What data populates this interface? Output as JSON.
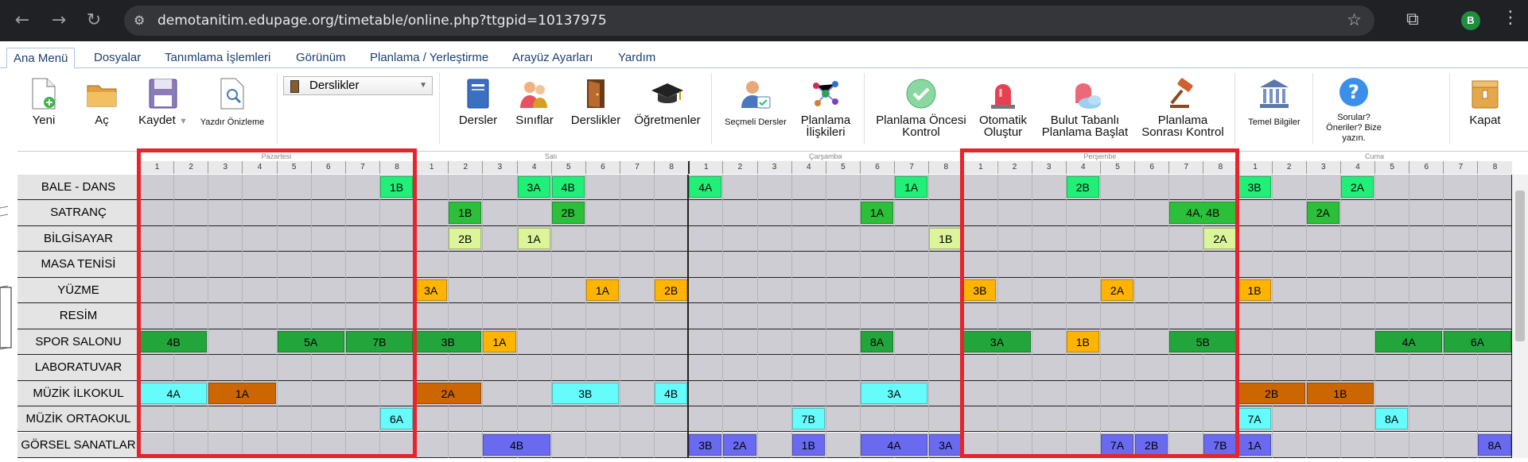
{
  "browser": {
    "url": "demotanitim.edupage.org/timetable/online.php?ttgpid=10137975",
    "profile_initial": "B"
  },
  "menu": [
    "Ana Menü",
    "Dosyalar",
    "Tanımlama İşlemleri",
    "Görünüm",
    "Planlama / Yerleştirme",
    "Arayüz Ayarları",
    "Yardım"
  ],
  "ribbon": {
    "yeni": "Yeni",
    "ac": "Aç",
    "kaydet": "Kaydet",
    "yazdir": "Yazdır Önizleme",
    "view_select": "Derslikler",
    "dersler": "Dersler",
    "siniflar": "Sınıflar",
    "derslikler": "Derslikler",
    "ogretmenler": "Öğretmenler",
    "secmeli_dersler": "Seçmeli Dersler",
    "planlama_iliskileri_1": "Planlama",
    "planlama_iliskileri_2": "İlişkileri",
    "planlama_oncesi_1": "Planlama Öncesi",
    "planlama_oncesi_2": "Kontrol",
    "otomatik_1": "Otomatik",
    "otomatik_2": "Oluştur",
    "bulut_1": "Bulut Tabanlı",
    "bulut_2": "Planlama Başlat",
    "sonrasi_1": "Planlama",
    "sonrasi_2": "Sonrası Kontrol",
    "temel_bilgiler": "Temel Bilgiler",
    "sorular_1": "Sorular?",
    "sorular_2": "Öneriler? Bize",
    "sorular_3": "yazın.",
    "kapat": "Kapat"
  },
  "days": [
    "Pazartesi",
    "Salı",
    "Çarşamba",
    "Perşembe",
    "Cuma"
  ],
  "periods": [
    "1",
    "2",
    "3",
    "4",
    "5",
    "6",
    "7",
    "8"
  ],
  "rooms": [
    "BALE - DANS",
    "SATRANÇ",
    "BİLGİSAYAR",
    "MASA TENİSİ",
    "YÜZME",
    "RESİM",
    "SPOR SALONU",
    "LABORATUVAR",
    "MÜZİK İLKOKUL",
    "MÜZİK ORTAOKUL",
    "GÖRSEL SANATLAR"
  ],
  "colors": {
    "green_light": "#21f078",
    "green_dark": "#22a63c",
    "green_mid": "#2bbf3a",
    "yellow_green": "#dcf59a",
    "orange": "#ffb400",
    "brown": "#cc6600",
    "cyan": "#67fcfc",
    "blue": "#6a6af0",
    "highlight": "#e8232b"
  },
  "lessons": [
    {
      "room": 0,
      "day": 0,
      "period": 7,
      "span": 1,
      "label": "1B",
      "color": "green_light"
    },
    {
      "room": 0,
      "day": 1,
      "period": 3,
      "span": 1,
      "label": "3A",
      "color": "green_light"
    },
    {
      "room": 0,
      "day": 1,
      "period": 4,
      "span": 1,
      "label": "4B",
      "color": "green_light"
    },
    {
      "room": 0,
      "day": 2,
      "period": 0,
      "span": 1,
      "label": "4A",
      "color": "green_light"
    },
    {
      "room": 0,
      "day": 2,
      "period": 6,
      "span": 1,
      "label": "1A",
      "color": "green_light"
    },
    {
      "room": 0,
      "day": 3,
      "period": 3,
      "span": 1,
      "label": "2B",
      "color": "green_light"
    },
    {
      "room": 0,
      "day": 4,
      "period": 0,
      "span": 1,
      "label": "3B",
      "color": "green_light"
    },
    {
      "room": 0,
      "day": 4,
      "period": 3,
      "span": 1,
      "label": "2A",
      "color": "green_light"
    },
    {
      "room": 1,
      "day": 1,
      "period": 1,
      "span": 1,
      "label": "1B",
      "color": "green_mid"
    },
    {
      "room": 1,
      "day": 1,
      "period": 4,
      "span": 1,
      "label": "2B",
      "color": "green_mid"
    },
    {
      "room": 1,
      "day": 2,
      "period": 5,
      "span": 1,
      "label": "1A",
      "color": "green_mid"
    },
    {
      "room": 1,
      "day": 3,
      "period": 6,
      "span": 2,
      "label": "4A, 4B",
      "color": "green_mid"
    },
    {
      "room": 1,
      "day": 4,
      "period": 2,
      "span": 1,
      "label": "2A",
      "color": "green_mid"
    },
    {
      "room": 2,
      "day": 1,
      "period": 1,
      "span": 1,
      "label": "2B",
      "color": "yellow_green"
    },
    {
      "room": 2,
      "day": 1,
      "period": 3,
      "span": 1,
      "label": "1A",
      "color": "yellow_green"
    },
    {
      "room": 2,
      "day": 2,
      "period": 7,
      "span": 1,
      "label": "1B",
      "color": "yellow_green"
    },
    {
      "room": 2,
      "day": 3,
      "period": 7,
      "span": 1,
      "label": "2A",
      "color": "yellow_green"
    },
    {
      "room": 4,
      "day": 1,
      "period": 0,
      "span": 1,
      "label": "3A",
      "color": "orange"
    },
    {
      "room": 4,
      "day": 1,
      "period": 5,
      "span": 1,
      "label": "1A",
      "color": "orange"
    },
    {
      "room": 4,
      "day": 1,
      "period": 7,
      "span": 1,
      "label": "2B",
      "color": "orange"
    },
    {
      "room": 4,
      "day": 3,
      "period": 0,
      "span": 1,
      "label": "3B",
      "color": "orange"
    },
    {
      "room": 4,
      "day": 3,
      "period": 4,
      "span": 1,
      "label": "2A",
      "color": "orange"
    },
    {
      "room": 4,
      "day": 4,
      "period": 0,
      "span": 1,
      "label": "1B",
      "color": "orange"
    },
    {
      "room": 6,
      "day": 0,
      "period": 0,
      "span": 2,
      "label": "4B",
      "color": "green_dark"
    },
    {
      "room": 6,
      "day": 0,
      "period": 4,
      "span": 2,
      "label": "5A",
      "color": "green_dark"
    },
    {
      "room": 6,
      "day": 0,
      "period": 6,
      "span": 2,
      "label": "7B",
      "color": "green_dark"
    },
    {
      "room": 6,
      "day": 1,
      "period": 0,
      "span": 2,
      "label": "3B",
      "color": "green_dark"
    },
    {
      "room": 6,
      "day": 1,
      "period": 2,
      "span": 1,
      "label": "1A",
      "color": "orange"
    },
    {
      "room": 6,
      "day": 2,
      "period": 5,
      "span": 1,
      "label": "8A",
      "color": "green_dark"
    },
    {
      "room": 6,
      "day": 3,
      "period": 0,
      "span": 2,
      "label": "3A",
      "color": "green_dark"
    },
    {
      "room": 6,
      "day": 3,
      "period": 3,
      "span": 1,
      "label": "1B",
      "color": "orange"
    },
    {
      "room": 6,
      "day": 3,
      "period": 6,
      "span": 2,
      "label": "5B",
      "color": "green_dark"
    },
    {
      "room": 6,
      "day": 4,
      "period": 4,
      "span": 2,
      "label": "4A",
      "color": "green_dark"
    },
    {
      "room": 6,
      "day": 4,
      "period": 6,
      "span": 2,
      "label": "6A",
      "color": "green_dark"
    },
    {
      "room": 8,
      "day": 0,
      "period": 0,
      "span": 2,
      "label": "4A",
      "color": "cyan"
    },
    {
      "room": 8,
      "day": 0,
      "period": 2,
      "span": 2,
      "label": "1A",
      "color": "brown"
    },
    {
      "room": 8,
      "day": 1,
      "period": 0,
      "span": 2,
      "label": "2A",
      "color": "brown"
    },
    {
      "room": 8,
      "day": 1,
      "period": 4,
      "span": 2,
      "label": "3B",
      "color": "cyan"
    },
    {
      "room": 8,
      "day": 1,
      "period": 7,
      "span": 1,
      "label": "4B",
      "color": "cyan"
    },
    {
      "room": 8,
      "day": 2,
      "period": 5,
      "span": 2,
      "label": "3A",
      "color": "cyan"
    },
    {
      "room": 8,
      "day": 4,
      "period": 0,
      "span": 2,
      "label": "2B",
      "color": "brown"
    },
    {
      "room": 8,
      "day": 4,
      "period": 2,
      "span": 2,
      "label": "1B",
      "color": "brown"
    },
    {
      "room": 9,
      "day": 0,
      "period": 7,
      "span": 1,
      "label": "6A",
      "color": "cyan"
    },
    {
      "room": 9,
      "day": 2,
      "period": 3,
      "span": 1,
      "label": "7B",
      "color": "cyan"
    },
    {
      "room": 9,
      "day": 4,
      "period": 0,
      "span": 1,
      "label": "7A",
      "color": "cyan"
    },
    {
      "room": 9,
      "day": 4,
      "period": 4,
      "span": 1,
      "label": "8A",
      "color": "cyan"
    },
    {
      "room": 10,
      "day": 1,
      "period": 2,
      "span": 2,
      "label": "4B",
      "color": "blue"
    },
    {
      "room": 10,
      "day": 2,
      "period": 0,
      "span": 1,
      "label": "3B",
      "color": "blue"
    },
    {
      "room": 10,
      "day": 2,
      "period": 1,
      "span": 1,
      "label": "2A",
      "color": "blue"
    },
    {
      "room": 10,
      "day": 2,
      "period": 3,
      "span": 1,
      "label": "1B",
      "color": "blue"
    },
    {
      "room": 10,
      "day": 2,
      "period": 5,
      "span": 2,
      "label": "4A",
      "color": "blue"
    },
    {
      "room": 10,
      "day": 2,
      "period": 7,
      "span": 1,
      "label": "3A",
      "color": "blue"
    },
    {
      "room": 10,
      "day": 3,
      "period": 4,
      "span": 1,
      "label": "7A",
      "color": "blue"
    },
    {
      "room": 10,
      "day": 3,
      "period": 5,
      "span": 1,
      "label": "2B",
      "color": "blue"
    },
    {
      "room": 10,
      "day": 3,
      "period": 7,
      "span": 1,
      "label": "7B",
      "color": "blue"
    },
    {
      "room": 10,
      "day": 4,
      "period": 0,
      "span": 1,
      "label": "1A",
      "color": "blue"
    },
    {
      "room": 10,
      "day": 4,
      "period": 7,
      "span": 1,
      "label": "8A",
      "color": "blue"
    }
  ]
}
